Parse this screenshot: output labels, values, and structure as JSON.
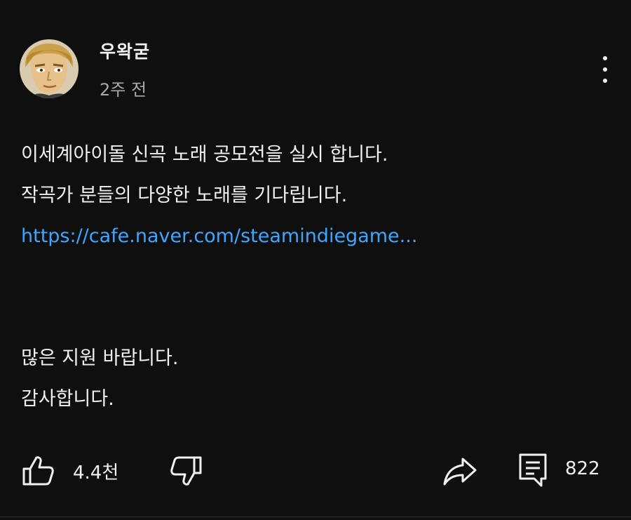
{
  "post": {
    "author": "우왁굳",
    "time": "2주 전",
    "lines": [
      "이세계아이돌 신곡 노래 공모전을 실시 합니다.",
      "작곡가 분들의 다양한 노래를 기다립니다."
    ],
    "link": "https://cafe.naver.com/steamindiegame...",
    "closing_lines": [
      "많은 지원 바랍니다.",
      "감사합니다."
    ]
  },
  "actions": {
    "like_count": "4.4천",
    "reply_count": "822"
  },
  "icons": {
    "avatar": "avatar-illustration",
    "more": "more-vertical-icon",
    "like": "thumbs-up-icon",
    "dislike": "thumbs-down-icon",
    "share": "share-icon",
    "reply": "comment-icon"
  },
  "colors": {
    "background": "#0f0f0f",
    "text": "#f1f1f1",
    "secondary_text": "#aaaaaa",
    "link": "#3ea6ff"
  }
}
